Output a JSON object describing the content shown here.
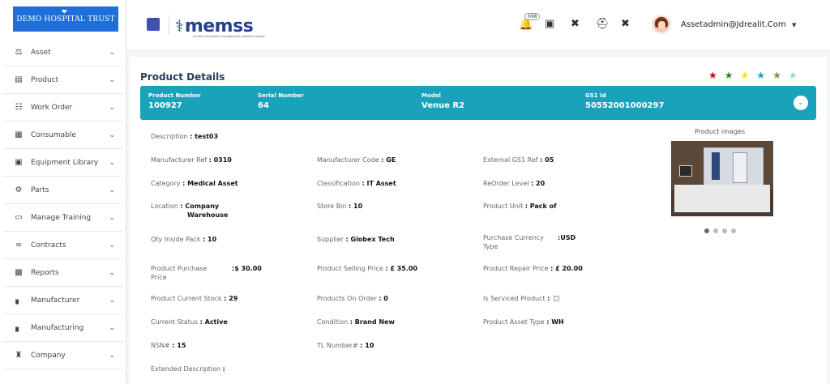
{
  "logo": {
    "text": "DEMO HOSPITAL TRUST"
  },
  "sidebar": {
    "items": [
      {
        "label": "Asset",
        "icon": "scale-icon"
      },
      {
        "label": "Product",
        "icon": "archive-icon"
      },
      {
        "label": "Work Order",
        "icon": "clipboard-icon"
      },
      {
        "label": "Consumable",
        "icon": "grid-icon"
      },
      {
        "label": "Equipment Library",
        "icon": "library-icon"
      },
      {
        "label": "Parts",
        "icon": "parts-icon"
      },
      {
        "label": "Manage Training",
        "icon": "monitor-icon"
      },
      {
        "label": "Contracts",
        "icon": "handshake-icon"
      },
      {
        "label": "Reports",
        "icon": "report-icon"
      },
      {
        "label": "Manufacturer",
        "icon": "factory-icon"
      },
      {
        "label": "Manufacturing",
        "icon": "factory-icon"
      },
      {
        "label": "Company",
        "icon": "building-icon"
      }
    ]
  },
  "header": {
    "brand": "memss",
    "tagline": "medical equipment management software solution",
    "notification_count": "698",
    "user": "Assetadmin@Jdrealit.Com"
  },
  "page": {
    "title": "Product Details"
  },
  "stars": [
    "#d0021b",
    "#1a8a2e",
    "#f2e600",
    "#1aa2bb",
    "#8a8a3a",
    "#7fe0e0"
  ],
  "banner": {
    "fields": [
      {
        "label": "Product Number",
        "value": "100927"
      },
      {
        "label": "Serial Number",
        "value": "64"
      },
      {
        "label": "Model",
        "value": "Venue R2"
      },
      {
        "label": "GS1 Id",
        "value": "50552001000297"
      }
    ]
  },
  "details": {
    "description": {
      "label": "Description",
      "value": "test03"
    },
    "manufacturer_ref": {
      "label": "Manufacturer Ref",
      "value": "0310"
    },
    "manufacturer_code": {
      "label": "Manufacturer Code",
      "value": "GE"
    },
    "external_gs1_ref": {
      "label": "External GS1 Ref",
      "value": "05"
    },
    "category": {
      "label": "Category",
      "value": "Medical Asset"
    },
    "classification": {
      "label": "Classification",
      "value": "IT Asset"
    },
    "reorder_level": {
      "label": "ReOrder Level",
      "value": "20"
    },
    "location": {
      "label": "Location",
      "value_line1": "Company",
      "value_line2": "Warehouse"
    },
    "store_bin": {
      "label": "Store Bin",
      "value": "10"
    },
    "product_unit": {
      "label": "Product Unit",
      "value": "Pack of"
    },
    "qty_inside_pack": {
      "label": "Qty Inside Pack",
      "value": "10"
    },
    "supplier": {
      "label": "Supplier",
      "value": "Globex Tech"
    },
    "purchase_currency_type": {
      "label_line1": "Purchase Currency",
      "label_line2": "Type",
      "value": "USD"
    },
    "product_purchase_price": {
      "label_line1": "Product Purchase",
      "label_line2": "Price",
      "value": "$ 30.00"
    },
    "product_selling_price": {
      "label": "Product Selling Price",
      "value": "£ 35.00"
    },
    "product_repair_price": {
      "label": "Product Repair Price",
      "value": "£ 20.00"
    },
    "product_current_stock": {
      "label": "Product Current Stock",
      "value": "29"
    },
    "products_on_order": {
      "label": "Products On Order",
      "value": "0"
    },
    "is_serviced_product": {
      "label": "Is Serviced Product"
    },
    "current_status": {
      "label": "Current Status",
      "value": "Active"
    },
    "condition": {
      "label": "Condition",
      "value": "Brand New"
    },
    "product_asset_type": {
      "label": "Product Asset Type",
      "value": "WH"
    },
    "nsn": {
      "label": "NSN#",
      "value": "15"
    },
    "tl_number": {
      "label": "TL Number#",
      "value": "10"
    },
    "extended_description": {
      "label": "Extended Description"
    }
  },
  "images": {
    "title": "Product images"
  }
}
